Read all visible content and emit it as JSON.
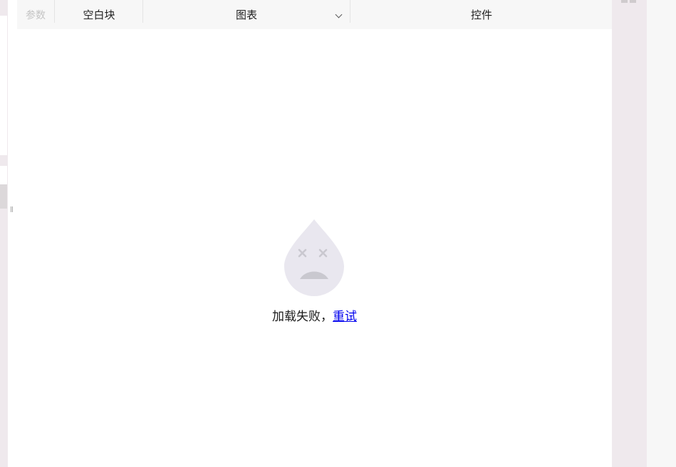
{
  "toolbar": {
    "params_label": "参数",
    "blank_label": "空白块",
    "chart_label": "图表",
    "control_label": "控件"
  },
  "empty_state": {
    "icon": "sad-drop-icon",
    "message": "加载失败，",
    "retry_label": "重试"
  },
  "colors": {
    "background": "#efe9ed",
    "toolbar": "#f7f7f7",
    "link": "#0000ee",
    "icon_fill": "#e9e7ef",
    "icon_face": "#c9c8cf"
  }
}
